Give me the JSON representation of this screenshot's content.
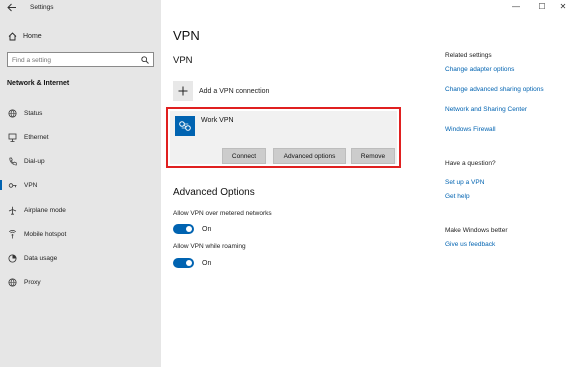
{
  "window": {
    "title": "Settings",
    "controls": {
      "minimize": "—",
      "maximize": "☐",
      "close": "✕"
    }
  },
  "sidebar": {
    "home_label": "Home",
    "search_placeholder": "Find a setting",
    "section_title": "Network & Internet",
    "items": [
      {
        "label": "Status",
        "icon": "globe-icon"
      },
      {
        "label": "Ethernet",
        "icon": "ethernet-icon"
      },
      {
        "label": "Dial-up",
        "icon": "phone-icon"
      },
      {
        "label": "VPN",
        "icon": "vpn-icon",
        "active": true
      },
      {
        "label": "Airplane mode",
        "icon": "airplane-icon"
      },
      {
        "label": "Mobile hotspot",
        "icon": "hotspot-icon"
      },
      {
        "label": "Data usage",
        "icon": "data-usage-icon"
      },
      {
        "label": "Proxy",
        "icon": "globe-icon"
      }
    ]
  },
  "main": {
    "title": "VPN",
    "vpn_heading": "VPN",
    "add_vpn_label": "Add a VPN connection",
    "connection": {
      "name": "Work VPN",
      "buttons": {
        "connect": "Connect",
        "advanced": "Advanced options",
        "remove": "Remove"
      }
    },
    "advanced": {
      "heading": "Advanced Options",
      "metered_label": "Allow VPN over metered networks",
      "metered_state": "On",
      "roaming_label": "Allow VPN while roaming",
      "roaming_state": "On"
    }
  },
  "right": {
    "related_title": "Related settings",
    "related_links": [
      "Change adapter options",
      "Change advanced sharing options",
      "Network and Sharing Center",
      "Windows Firewall"
    ],
    "question_title": "Have a question?",
    "question_links": [
      "Set up a VPN",
      "Get help"
    ],
    "better_title": "Make Windows better",
    "feedback_link": "Give us feedback"
  },
  "colors": {
    "accent": "#0063b1",
    "highlight_border": "#e02020",
    "sidebar_bg": "#e6e6e6"
  }
}
